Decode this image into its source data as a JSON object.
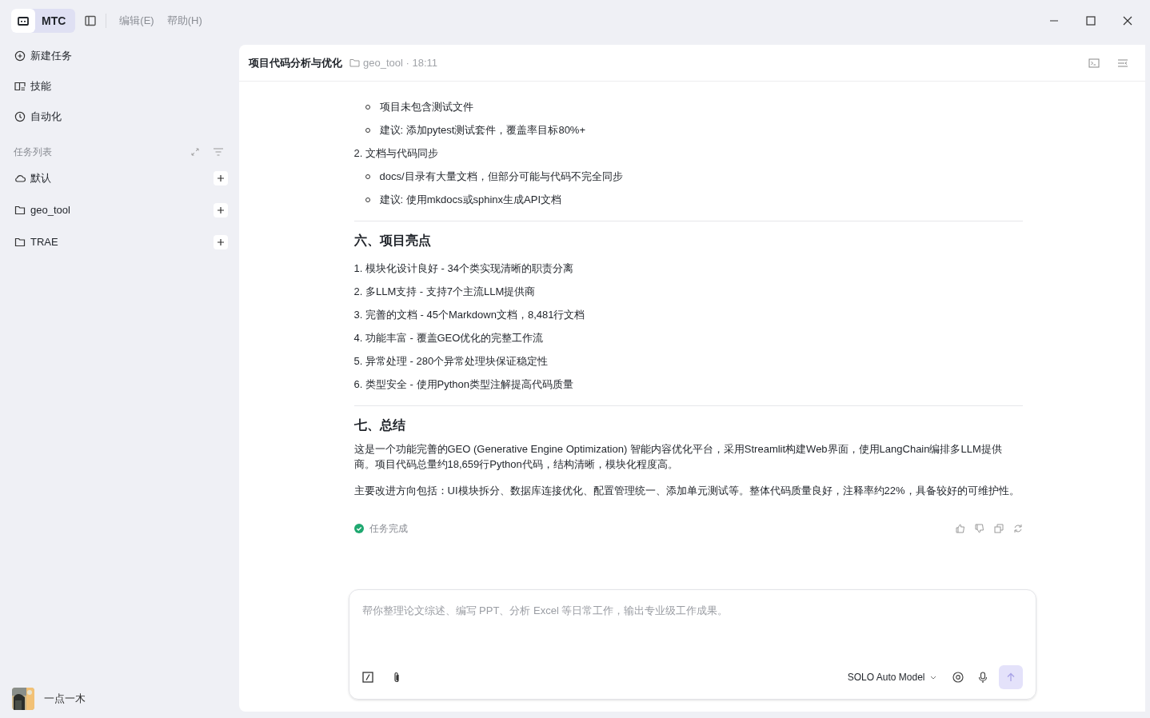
{
  "app": {
    "name": "MTC",
    "menus": [
      "编辑(E)",
      "帮助(H)"
    ]
  },
  "sidebar": {
    "nav": [
      {
        "kind": "new",
        "label": "新建任务"
      },
      {
        "kind": "skills",
        "label": "技能"
      },
      {
        "kind": "auto",
        "label": "自动化"
      }
    ],
    "section_title": "任务列表",
    "groups": [
      {
        "kind": "cloud",
        "label": "默认"
      },
      {
        "kind": "folder",
        "label": "geo_tool"
      },
      {
        "kind": "folder",
        "label": "TRAE"
      }
    ],
    "user": {
      "name": "一点一木"
    }
  },
  "header": {
    "title": "项目代码分析与优化",
    "meta": "geo_tool · 18:11"
  },
  "content": [
    {
      "kind": "bullet",
      "text": "项目未包含测试文件"
    },
    {
      "kind": "bullet",
      "text": "建议: 添加pytest测试套件，覆盖率目标80%+"
    },
    {
      "kind": "item",
      "text": "2. 文档与代码同步"
    },
    {
      "kind": "bullet",
      "text": "docs/目录有大量文档，但部分可能与代码不完全同步"
    },
    {
      "kind": "bullet",
      "text": "建议: 使用mkdocs或sphinx生成API文档"
    },
    {
      "kind": "rule"
    },
    {
      "kind": "heading",
      "text": "六、项目亮点"
    },
    {
      "kind": "item",
      "text": "1. 模块化设计良好 - 34个类实现清晰的职责分离"
    },
    {
      "kind": "item",
      "text": "2. 多LLM支持 - 支持7个主流LLM提供商"
    },
    {
      "kind": "item",
      "text": "3. 完善的文档 - 45个Markdown文档，8,481行文档"
    },
    {
      "kind": "item",
      "text": "4. 功能丰富 - 覆盖GEO优化的完整工作流"
    },
    {
      "kind": "item",
      "text": "5. 异常处理 - 280个异常处理块保证稳定性"
    },
    {
      "kind": "item",
      "text": "6. 类型安全 - 使用Python类型注解提高代码质量"
    },
    {
      "kind": "rule"
    },
    {
      "kind": "heading",
      "text": "七、总结"
    },
    {
      "kind": "paragraph",
      "text": "这是一个功能完善的GEO (Generative Engine Optimization) 智能内容优化平台，采用Streamlit构建Web界面，使用LangChain编排多LLM提供商。项目代码总量约18,659行Python代码，结构清晰，模块化程度高。"
    },
    {
      "kind": "paragraph",
      "text": "主要改进方向包括：UI模块拆分、数据库连接优化、配置管理统一、添加单元测试等。整体代码质量良好，注释率约22%，具备较好的可维护性。"
    }
  ],
  "status": {
    "text": "任务完成"
  },
  "composer": {
    "placeholder": "帮你整理论文综述、编写 PPT、分析 Excel 等日常工作，输出专业级工作成果。",
    "model": "SOLO Auto Model"
  }
}
